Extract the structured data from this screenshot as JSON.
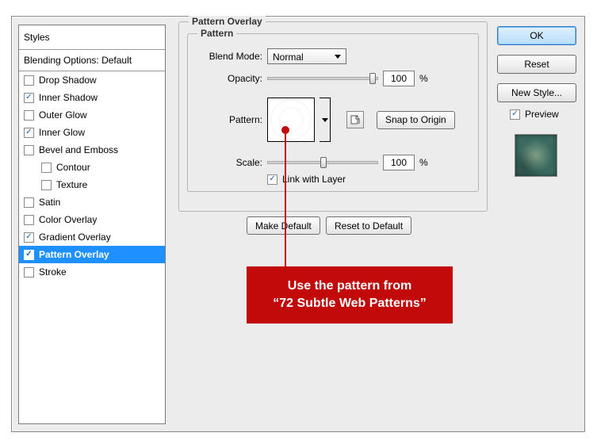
{
  "styles_panel": {
    "title": "Styles",
    "subtitle": "Blending Options: Default",
    "items": [
      {
        "label": "Drop Shadow",
        "checked": false,
        "indent": false,
        "selected": false
      },
      {
        "label": "Inner Shadow",
        "checked": true,
        "indent": false,
        "selected": false
      },
      {
        "label": "Outer Glow",
        "checked": false,
        "indent": false,
        "selected": false
      },
      {
        "label": "Inner Glow",
        "checked": true,
        "indent": false,
        "selected": false
      },
      {
        "label": "Bevel and Emboss",
        "checked": false,
        "indent": false,
        "selected": false
      },
      {
        "label": "Contour",
        "checked": false,
        "indent": true,
        "selected": false
      },
      {
        "label": "Texture",
        "checked": false,
        "indent": true,
        "selected": false
      },
      {
        "label": "Satin",
        "checked": false,
        "indent": false,
        "selected": false
      },
      {
        "label": "Color Overlay",
        "checked": false,
        "indent": false,
        "selected": false
      },
      {
        "label": "Gradient Overlay",
        "checked": true,
        "indent": false,
        "selected": false
      },
      {
        "label": "Pattern Overlay",
        "checked": true,
        "indent": false,
        "selected": true
      },
      {
        "label": "Stroke",
        "checked": false,
        "indent": false,
        "selected": false
      }
    ]
  },
  "overlay": {
    "outer_legend": "Pattern Overlay",
    "inner_legend": "Pattern",
    "blend_mode_label": "Blend Mode:",
    "blend_mode_value": "Normal",
    "opacity_label": "Opacity:",
    "opacity_value": "100",
    "opacity_unit": "%",
    "pattern_label": "Pattern:",
    "snap_label": "Snap to Origin",
    "scale_label": "Scale:",
    "scale_value": "100",
    "scale_unit": "%",
    "link_label": "Link with Layer",
    "link_checked": true
  },
  "buttons": {
    "make_default": "Make Default",
    "reset_default": "Reset to Default",
    "ok": "OK",
    "reset": "Reset",
    "new_style": "New Style...",
    "preview": "Preview"
  },
  "annotation": {
    "line1": "Use the pattern from",
    "line2": "“72 Subtle Web Patterns”"
  }
}
